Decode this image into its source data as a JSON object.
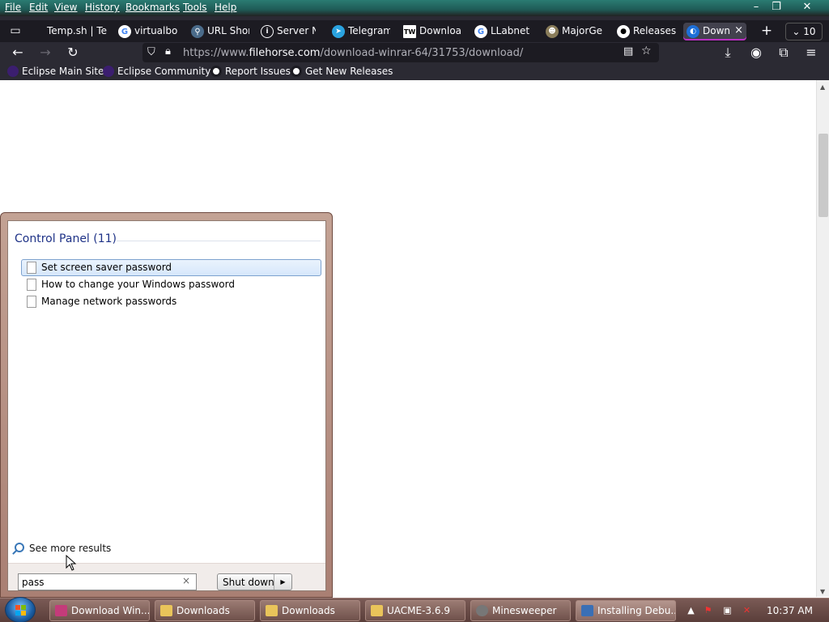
{
  "menubar": {
    "items": [
      "File",
      "Edit",
      "View",
      "History",
      "Bookmarks",
      "Tools",
      "Help"
    ]
  },
  "window_controls": {
    "minimize": "–",
    "restore": "❐",
    "close": "✕"
  },
  "tabs": [
    {
      "label": "Temp.sh | Te",
      "icon": "temp-icon"
    },
    {
      "label": "virtualbo",
      "icon": "google-icon"
    },
    {
      "label": "URL Shor",
      "icon": "link-icon"
    },
    {
      "label": "Server N",
      "icon": "info-icon"
    },
    {
      "label": "Telegram",
      "icon": "telegram-icon"
    },
    {
      "label": "Downloa",
      "icon": "tw-icon"
    },
    {
      "label": "LLabnet",
      "icon": "google-icon"
    },
    {
      "label": "MajorGe",
      "icon": "majorgeeks-icon"
    },
    {
      "label": "Releases",
      "icon": "github-icon"
    },
    {
      "label": "Down",
      "icon": "filehorse-icon",
      "active": true
    }
  ],
  "tab_count": "10",
  "new_tab": "+",
  "url": {
    "prefix": "https://www.",
    "domain": "filehorse.com",
    "path": "/download-winrar-64/31753/download/"
  },
  "bookmarks": [
    {
      "label": "Eclipse Main Site",
      "icon": "eclipse-icon"
    },
    {
      "label": "Eclipse Community",
      "icon": "eclipse-icon"
    },
    {
      "label": "Report Issues",
      "icon": "github-icon"
    },
    {
      "label": "Get New Releases",
      "icon": "github-icon"
    }
  ],
  "start_menu": {
    "heading": "Control Panel (11)",
    "results": [
      {
        "label": "Set screen saver password",
        "selected": true
      },
      {
        "label": "How to change your Windows password"
      },
      {
        "label": "Manage network passwords"
      }
    ],
    "see_more": "See more results",
    "search_value": "pass",
    "search_clear": "×",
    "shutdown_label": "Shut down",
    "shutdown_arrow": "▶"
  },
  "taskbar": {
    "items": [
      {
        "label": "Download Win...",
        "icon": "firefox-icon",
        "color": "#c43b7a"
      },
      {
        "label": "Downloads",
        "icon": "folder-icon",
        "color": "#e9c45a"
      },
      {
        "label": "Downloads",
        "icon": "folder-icon",
        "color": "#e9c45a"
      },
      {
        "label": "UACME-3.6.9",
        "icon": "folder-icon",
        "color": "#e9c45a"
      },
      {
        "label": "Minesweeper",
        "icon": "minesweeper-icon",
        "color": "#777777"
      },
      {
        "label": "Installing Debu...",
        "icon": "installer-icon",
        "color": "#3a6fb5",
        "active": true
      }
    ],
    "clock": "10:37 AM"
  }
}
